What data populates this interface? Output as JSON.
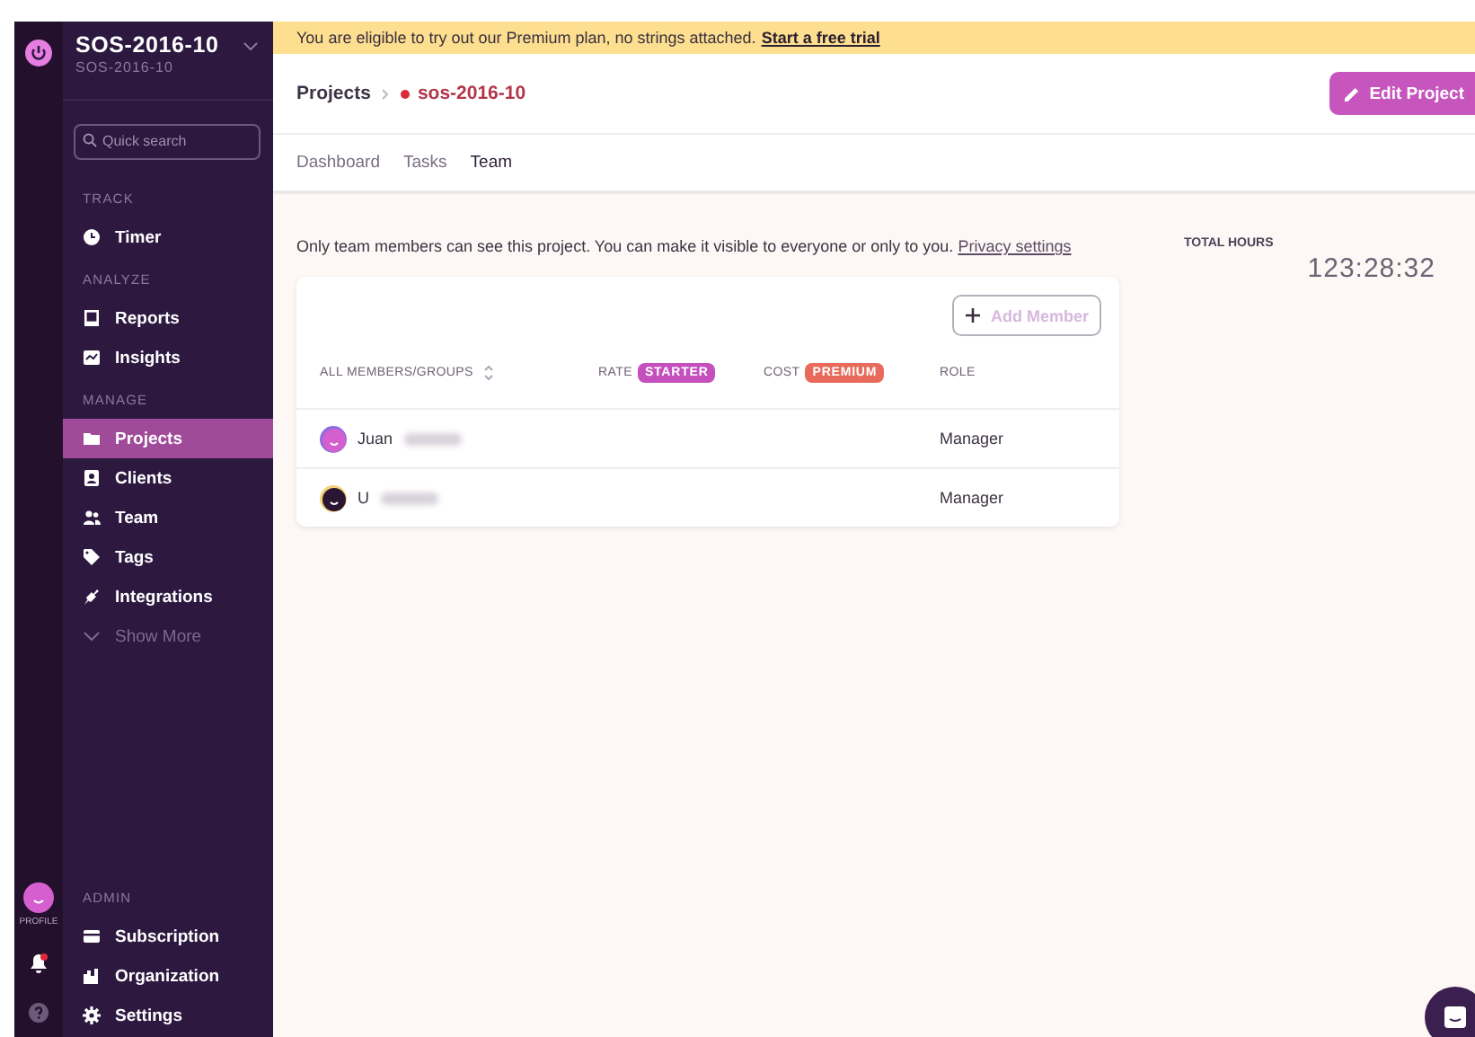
{
  "workspace": {
    "name": "SOS-2016-10",
    "subtitle": "SOS-2016-10"
  },
  "rail": {
    "profile_label": "PROFILE",
    "notification": true
  },
  "search": {
    "placeholder": "Quick search"
  },
  "sidebar": {
    "sections": [
      {
        "title": "TRACK",
        "items": [
          {
            "label": "Timer",
            "selected": false
          }
        ]
      },
      {
        "title": "ANALYZE",
        "items": [
          {
            "label": "Reports",
            "selected": false
          },
          {
            "label": "Insights",
            "selected": false
          }
        ]
      },
      {
        "title": "MANAGE",
        "items": [
          {
            "label": "Projects",
            "selected": true
          },
          {
            "label": "Clients",
            "selected": false
          },
          {
            "label": "Team",
            "selected": false
          },
          {
            "label": "Tags",
            "selected": false
          },
          {
            "label": "Integrations",
            "selected": false
          }
        ],
        "show_more": "Show More"
      }
    ],
    "admin": {
      "title": "ADMIN",
      "items": [
        {
          "label": "Subscription",
          "selected": false
        },
        {
          "label": "Organization",
          "selected": false
        },
        {
          "label": "Settings",
          "selected": false
        }
      ]
    }
  },
  "banner": {
    "text": "You are eligible to try out our Premium plan, no strings attached.",
    "link": "Start a free trial"
  },
  "breadcrumb": {
    "parent": "Projects",
    "project": "sos-2016-10"
  },
  "edit_button": "Edit Project",
  "tabs": [
    {
      "label": "Dashboard",
      "selected": false
    },
    {
      "label": "Tasks",
      "selected": false
    },
    {
      "label": "Team",
      "selected": true
    }
  ],
  "notice": {
    "text": "Only team members can see this project. You can make it visible to everyone or only to you.",
    "link": "Privacy settings"
  },
  "add_member": {
    "label": "Add Member",
    "disabled": true
  },
  "table": {
    "columns": [
      {
        "label": "ALL MEMBERS/GROUPS",
        "sortable": true
      },
      {
        "label": "RATE",
        "badge": "STARTER"
      },
      {
        "label": "COST",
        "badge": "PREMIUM"
      },
      {
        "label": "ROLE"
      }
    ],
    "rows": [
      {
        "name": "Juan",
        "role": "Manager"
      },
      {
        "name": "U",
        "role": "Manager"
      }
    ]
  },
  "total": {
    "label": "TOTAL HOURS",
    "value": "123:28:32"
  }
}
